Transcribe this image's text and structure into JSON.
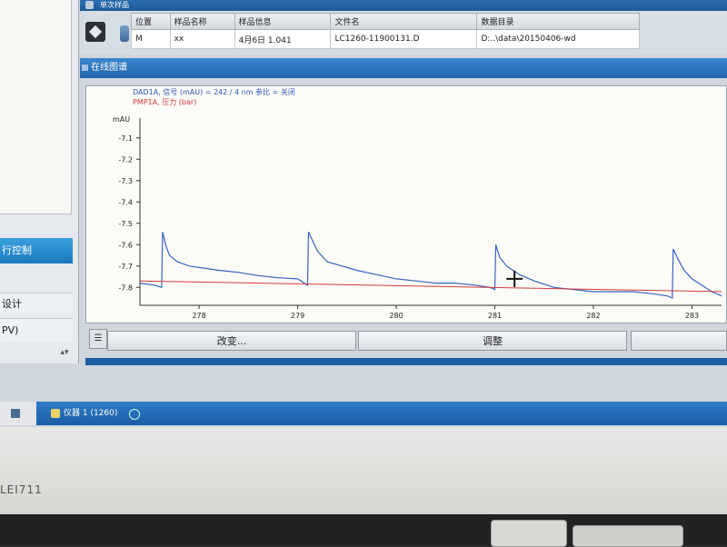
{
  "left_pane": {
    "run_control_label": "行控制",
    "design_label": "设计",
    "pv_label": "PV)"
  },
  "single_sample": {
    "title": "单次样品",
    "columns": [
      "位置",
      "样品名称",
      "样品信息",
      "文件名",
      "数据目录"
    ],
    "row": [
      "M",
      "xx",
      "4月6日  1.041",
      "LC1260-11900131.D",
      "D:..\\data\\20150406-wd"
    ]
  },
  "online_signal": {
    "title": "在线图谱",
    "legend": {
      "dad": "DAD1A, 信号 (mAU) = 242 / 4 nm 参比 = 关闭",
      "pmp": "PMP1A, 压力 (bar)"
    }
  },
  "chart_data": {
    "type": "line",
    "ylabel": "mAU",
    "xlim": [
      277.4,
      283.3
    ],
    "ylim": [
      -7.85,
      -7.05
    ],
    "xticks": [
      278,
      279,
      280,
      281,
      282,
      283
    ],
    "yticks": [
      "-7.1",
      "-7.2",
      "-7.3",
      "-7.4",
      "-7.5",
      "-7.6",
      "-7.7",
      "-7.8"
    ],
    "grid": false,
    "series": [
      {
        "color": "#3b63c2",
        "x": [
          277.4,
          277.55,
          277.62,
          277.63,
          277.66,
          277.7,
          277.78,
          277.9,
          278.05,
          278.2,
          278.4,
          278.6,
          278.8,
          279.0,
          279.1,
          279.11,
          279.15,
          279.2,
          279.3,
          279.45,
          279.6,
          279.8,
          280.0,
          280.2,
          280.4,
          280.6,
          280.8,
          280.95,
          281.0,
          281.01,
          281.05,
          281.12,
          281.25,
          281.4,
          281.6,
          281.8,
          282.0,
          282.2,
          282.4,
          282.6,
          282.75,
          282.8,
          282.81,
          282.86,
          282.92,
          283.0,
          283.1,
          283.2,
          283.3
        ],
        "values": [
          -7.78,
          -7.79,
          -7.8,
          -7.54,
          -7.6,
          -7.65,
          -7.68,
          -7.7,
          -7.71,
          -7.72,
          -7.73,
          -7.745,
          -7.755,
          -7.76,
          -7.79,
          -7.54,
          -7.58,
          -7.63,
          -7.68,
          -7.7,
          -7.72,
          -7.74,
          -7.76,
          -7.77,
          -7.78,
          -7.78,
          -7.79,
          -7.8,
          -7.81,
          -7.6,
          -7.66,
          -7.7,
          -7.74,
          -7.77,
          -7.8,
          -7.81,
          -7.82,
          -7.82,
          -7.82,
          -7.83,
          -7.84,
          -7.85,
          -7.62,
          -7.67,
          -7.72,
          -7.76,
          -7.79,
          -7.82,
          -7.84
        ]
      },
      {
        "color": "#d43a3a",
        "x": [
          277.4,
          283.3
        ],
        "values": [
          -7.77,
          -7.82
        ]
      }
    ]
  },
  "buttons": {
    "change": "改变...",
    "adjust": "调整"
  },
  "taskbar": {
    "instrument": "仪器 1 (1260)"
  },
  "bezel": {
    "brand": "LEI711"
  }
}
